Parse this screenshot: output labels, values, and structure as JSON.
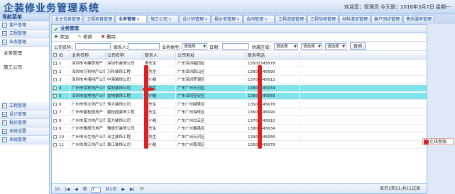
{
  "header": {
    "title": "企装修业务管理系统",
    "userinfo": "欢迎您：管理员  今天是：2016年3月7日 星期一"
  },
  "sidebar": {
    "title": "导航菜单",
    "items_top": [
      {
        "label": "客户管理",
        "icon": "folder-icon"
      },
      {
        "label": "工程管理",
        "icon": "folder-icon"
      },
      {
        "label": "业务管理",
        "icon": "folder-icon"
      }
    ],
    "sub_items": [
      "业务管理",
      "施工公司"
    ],
    "items_bottom": [
      {
        "label": "工程管理",
        "icon": "folder-icon"
      },
      {
        "label": "设计管理",
        "icon": "folder-icon"
      },
      {
        "label": "报价管理",
        "icon": "folder-icon"
      },
      {
        "label": "系统设置",
        "icon": "folder-icon"
      },
      {
        "label": "系统管理",
        "icon": "folder-icon"
      }
    ]
  },
  "tabs": [
    {
      "label": "业主信息管理"
    },
    {
      "label": "工程项目管理"
    },
    {
      "label": "业务管理",
      "active": true
    },
    {
      "label": "施工公司"
    },
    {
      "label": "设计师管理"
    },
    {
      "label": "报价单管理"
    },
    {
      "label": "合同管理"
    },
    {
      "label": "工程进度管理"
    },
    {
      "label": "工程验收管理"
    },
    {
      "label": "材料清单管理"
    },
    {
      "label": "客户回访管理"
    },
    {
      "label": "售后服务管理"
    }
  ],
  "panel": {
    "title": "业务管理"
  },
  "toolbar": {
    "add": "添加",
    "edit": "修改",
    "delete": "删除"
  },
  "search": {
    "label_company": "公司名称：",
    "label_contact": "联系人：",
    "label_type": "业务类型：",
    "type_value": "请选择",
    "label_date": "日期：",
    "label_region": "所属区域：",
    "region_value": "请选择",
    "select2_value": "请选择",
    "select3_value": "请选择",
    "button": "查询"
  },
  "grid": {
    "headers": [
      "",
      "ID",
      "业务名称",
      "公司名称",
      "联系人",
      "公司地址",
      "联系电话"
    ],
    "rows": [
      {
        "id": "1",
        "name": "深圳市中建房地产",
        "company": "深圳市装饰公司",
        "contact": "李先生",
        "address": "广东深圳福田区",
        "phone": "13502345678",
        "selected": false
      },
      {
        "id": "2",
        "name": "深圳市万科地产公司",
        "company": "万科装饰工程",
        "contact": "王先生",
        "address": "广东深圳南山区",
        "phone": "13602345690",
        "selected": false
      },
      {
        "id": "3",
        "name": "深圳市中海地产公司",
        "company": "中海装饰公司",
        "contact": "张小姐",
        "address": "广东深圳罗湖区",
        "phone": "13702345612",
        "selected": false
      },
      {
        "id": "4",
        "name": "广州市保利地产公司",
        "company": "保利装饰公司",
        "contact": "陈先生",
        "address": "广东广州天河区",
        "phone": "13802345634",
        "selected": true
      },
      {
        "id": "5",
        "name": "深圳市金地地产公司",
        "company": "金地装饰工程",
        "contact": "刘小姐",
        "address": "广东深圳宝安区",
        "phone": "13902345656",
        "selected": true
      },
      {
        "id": "6",
        "name": "广州市恒大地产公司",
        "company": "恒大装饰公司",
        "contact": "黄先生",
        "address": "广东广州越秀区",
        "phone": "13502345678",
        "selected": false
      },
      {
        "id": "7",
        "name": "广州市碧桂园地产",
        "company": "碧桂园装饰工程",
        "contact": "赵先生",
        "address": "广东广州海珠区",
        "phone": "13602345690",
        "selected": false
      },
      {
        "id": "8",
        "name": "广州市富力地产公司",
        "company": "富力装饰公司",
        "contact": "周小姐",
        "address": "广东广州白云区",
        "phone": "13702345612",
        "selected": false
      },
      {
        "id": "9",
        "name": "广州市雅居乐地产",
        "company": "雅居乐装饰公司",
        "contact": "吴先生",
        "address": "广东广州番禺区",
        "phone": "13802345634",
        "selected": false
      },
      {
        "id": "10",
        "name": "广州市合生地产公司",
        "company": "合生装饰工程",
        "contact": "郑先生",
        "address": "广东广州天河区",
        "phone": "13902345656",
        "selected": false
      },
      {
        "id": "11",
        "name": "广州市珠江地产公司",
        "company": "珠江装饰公司",
        "contact": "孙小姐",
        "address": "广东广州荔湾区",
        "phone": "13502345678",
        "selected": false
      }
    ]
  },
  "pager": {
    "page_size": "10",
    "page_label": "第",
    "page_value": "1",
    "page_total": "共1页",
    "info": "显示1到11,共11记录"
  },
  "feedback": {
    "label": "在线客服"
  },
  "colors": {
    "accent": "#15428b",
    "selected_row": "#7fe3ea",
    "mark": "#e02020"
  }
}
